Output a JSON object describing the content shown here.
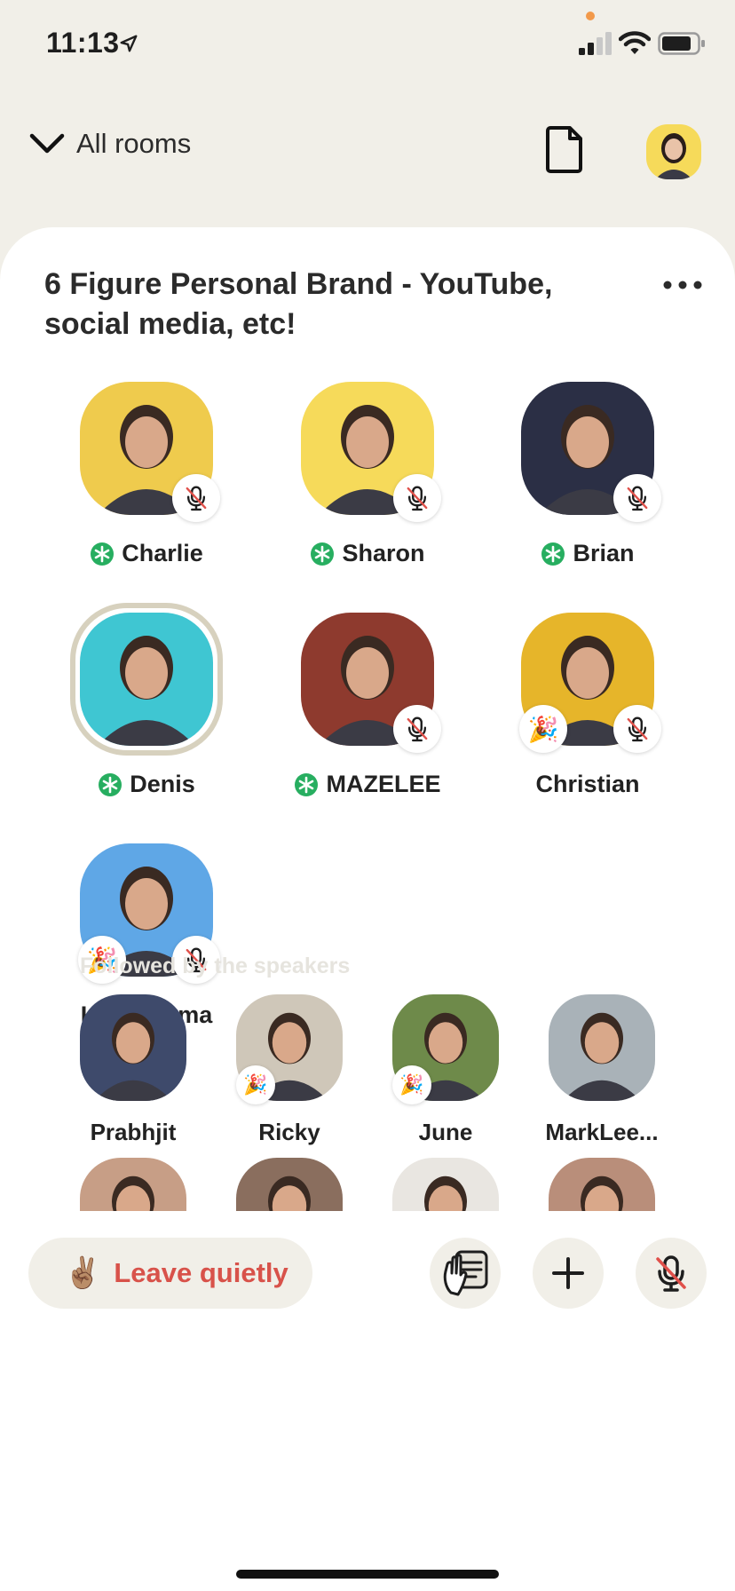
{
  "status_bar": {
    "time": "11:13"
  },
  "nav": {
    "all_rooms_label": "All rooms"
  },
  "room": {
    "title": "6 Figure Personal Brand - YouTube, social media, etc!",
    "speakers": [
      {
        "name": "Charlie",
        "moderator": true,
        "muted": true,
        "new_user": false,
        "bg": "#EFCB4D"
      },
      {
        "name": "Sharon",
        "moderator": true,
        "muted": true,
        "new_user": false,
        "bg": "#F6DA5A"
      },
      {
        "name": "Brian",
        "moderator": true,
        "muted": true,
        "new_user": false,
        "bg": "#2B2F45"
      },
      {
        "name": "Denis",
        "moderator": true,
        "muted": false,
        "new_user": false,
        "bg": "#3FC6D2"
      },
      {
        "name": "MAZELEE",
        "moderator": true,
        "muted": true,
        "new_user": false,
        "bg": "#8E3A2E"
      },
      {
        "name": "Christian",
        "moderator": false,
        "muted": true,
        "new_user": true,
        "bg": "#E6B52A"
      },
      {
        "name": "Little Mama",
        "moderator": false,
        "muted": true,
        "new_user": true,
        "bg": "#5FA7E6"
      }
    ],
    "section_label": "Followed by the speakers",
    "listeners": [
      {
        "name": "Prabhjit",
        "new_user": false,
        "bg": "#3E4A6B"
      },
      {
        "name": "Ricky",
        "new_user": true,
        "bg": "#CFC7B9"
      },
      {
        "name": "June",
        "new_user": true,
        "bg": "#6E8A4A"
      },
      {
        "name": "MarkLee...",
        "new_user": false,
        "bg": "#A9B2B8"
      }
    ],
    "more_listener_colors": [
      "#C79E86",
      "#8A6E5E",
      "#E9E6E1",
      "#B98E7A"
    ]
  },
  "bottom": {
    "leave_emoji": "✌🏽",
    "leave_label": "Leave quietly"
  },
  "colors": {
    "background": "#F1EFE8",
    "moderator_green": "#27AE60",
    "leave_red": "#D8524A",
    "mute_red": "#E0504A"
  }
}
